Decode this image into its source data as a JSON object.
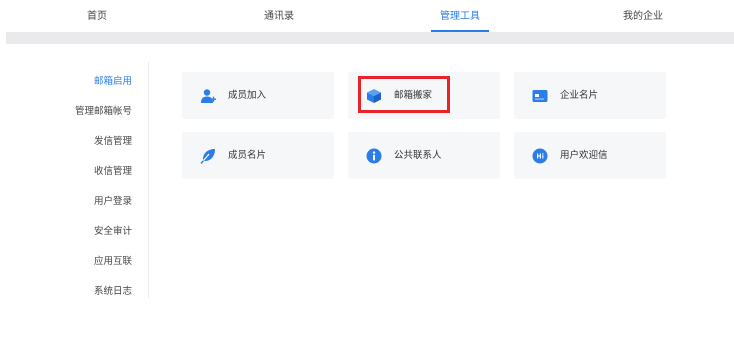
{
  "topnav": {
    "tabs": [
      {
        "label": "首页"
      },
      {
        "label": "通讯录"
      },
      {
        "label": "管理工具"
      },
      {
        "label": "我的企业"
      }
    ],
    "active_index": 2
  },
  "sidebar": {
    "items": [
      {
        "label": "邮箱启用"
      },
      {
        "label": "管理邮箱帐号"
      },
      {
        "label": "发信管理"
      },
      {
        "label": "收信管理"
      },
      {
        "label": "用户登录"
      },
      {
        "label": "安全审计"
      },
      {
        "label": "应用互联"
      },
      {
        "label": "系统日志"
      }
    ],
    "active_index": 0
  },
  "tools": [
    {
      "label": "成员加入",
      "icon": "add-member-icon"
    },
    {
      "label": "邮箱搬家",
      "icon": "box-icon"
    },
    {
      "label": "企业名片",
      "icon": "card-icon"
    },
    {
      "label": "成员名片",
      "icon": "feather-icon"
    },
    {
      "label": "公共联系人",
      "icon": "info-icon"
    },
    {
      "label": "用户欢迎信",
      "icon": "chat-bubble-icon"
    }
  ],
  "colors": {
    "accent": "#2b7de9",
    "highlight": "#e8242b",
    "card_bg": "#f6f7f9"
  }
}
